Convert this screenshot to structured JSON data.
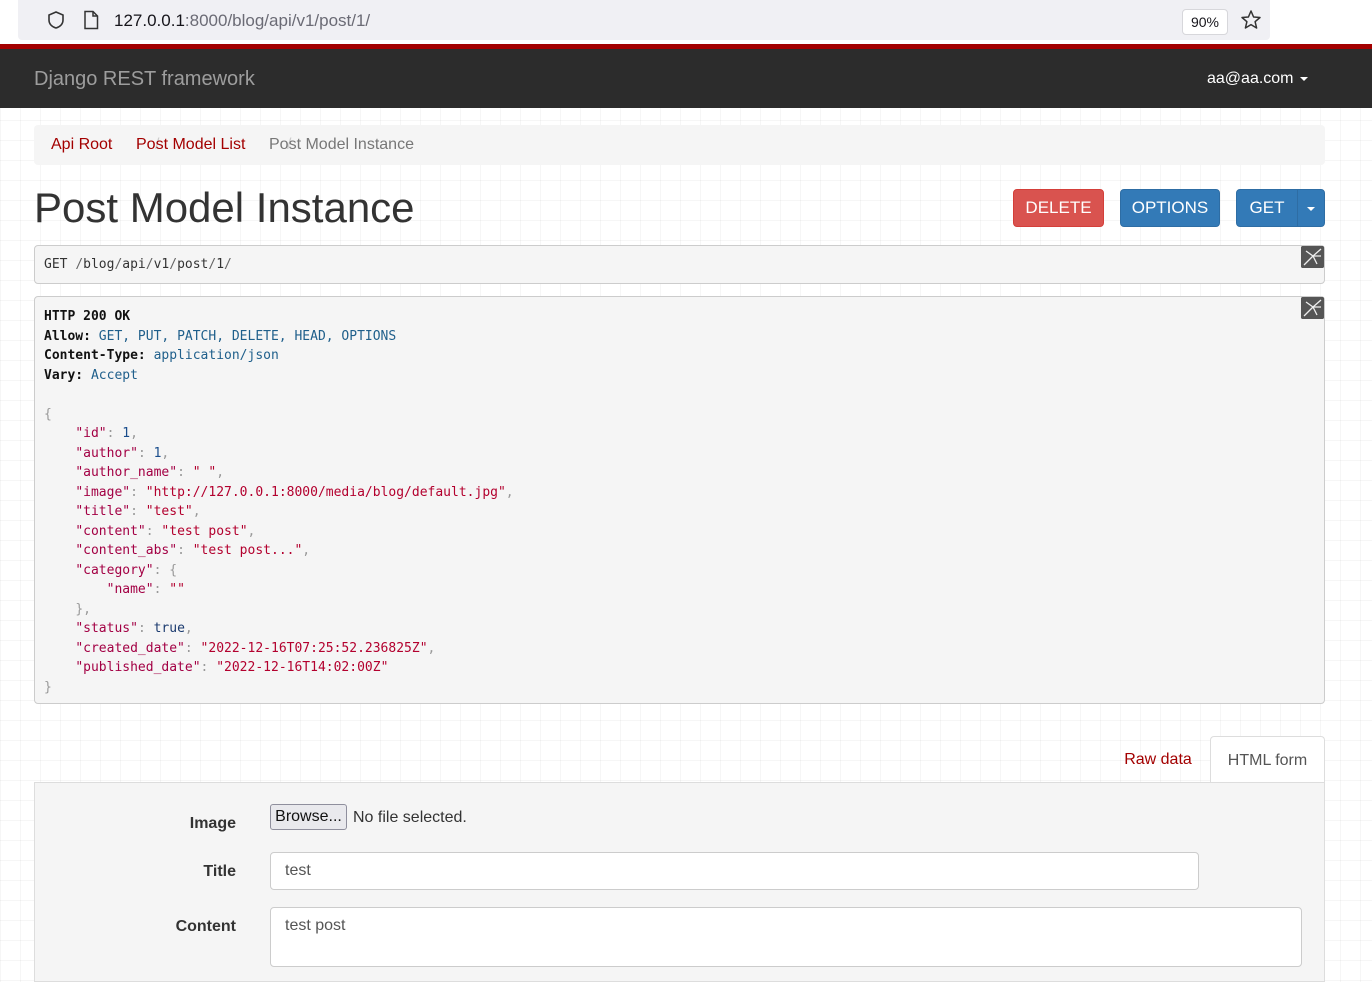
{
  "browser": {
    "url_host": "127.0.0.1",
    "url_rest": ":8000/blog/api/v1/post/1/",
    "zoom": "90%"
  },
  "navbar": {
    "brand": "Django REST framework",
    "user": "aa@aa.com"
  },
  "breadcrumb": {
    "items": [
      "Api Root",
      "Post Model List",
      "Post Model Instance"
    ],
    "separator": "/"
  },
  "page": {
    "title": "Post Model Instance"
  },
  "buttons": {
    "delete": "DELETE",
    "options": "OPTIONS",
    "get": "GET"
  },
  "request": {
    "method": "GET",
    "path_segments": [
      "blog",
      "api",
      "v1",
      "post",
      "1"
    ]
  },
  "response": {
    "status_line": "HTTP 200 OK",
    "headers": [
      {
        "key": "Allow:",
        "value": "GET, PUT, PATCH, DELETE, HEAD, OPTIONS"
      },
      {
        "key": "Content-Type:",
        "value": "application/json"
      },
      {
        "key": "Vary:",
        "value": "Accept"
      }
    ],
    "body": {
      "id": 1,
      "author": 1,
      "author_name": " ",
      "image": "http://127.0.0.1:8000/media/blog/default.jpg",
      "title": "test",
      "content": "test post",
      "content_abs": "test post...",
      "category": {
        "name": ""
      },
      "status": true,
      "created_date": "2022-12-16T07:25:52.236825Z",
      "published_date": "2022-12-16T14:02:00Z"
    }
  },
  "tabs": {
    "raw": "Raw data",
    "html": "HTML form"
  },
  "form": {
    "image_label": "Image",
    "browse_label": "Browse...",
    "no_file": "No file selected.",
    "title_label": "Title",
    "title_value": "test",
    "content_label": "Content",
    "content_value": "test post"
  }
}
